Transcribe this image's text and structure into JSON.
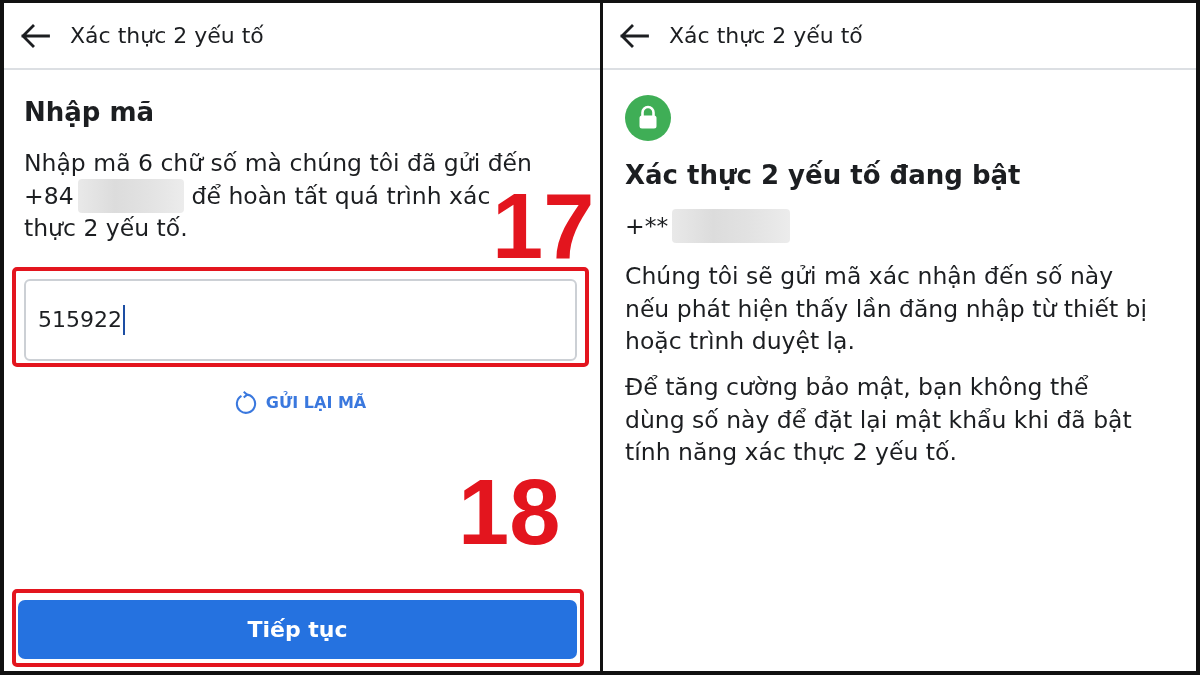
{
  "left_screen": {
    "header": {
      "title": "Xác thực 2 yếu tố"
    },
    "heading": "Nhập mã",
    "description_lines": [
      {
        "kind": "text",
        "text": "Nhập mã 6 chữ số mà chúng tôi đã gửi đến"
      },
      {
        "kind": "redacted",
        "before": "+84",
        "after": "để hoàn tất quá trình xác"
      },
      {
        "kind": "text",
        "text": "thực 2 yếu tố."
      }
    ],
    "code_input": {
      "value": "515922",
      "focused": true,
      "highlighted": true,
      "step_number": "17"
    },
    "resend_link": {
      "label": "GỬI LẠI MÃ"
    },
    "continue_button": {
      "label": "Tiếp tục",
      "highlighted": true,
      "step_number": "18"
    }
  },
  "right_screen": {
    "header": {
      "title": "Xác thực 2 yếu tố"
    },
    "heading": "Xác thực 2 yếu tố đang bật",
    "phone_line": {
      "kind": "redacted",
      "before": "+**"
    },
    "paragraphs": [
      "Chúng tôi sẽ gửi mã xác nhận đến số này nếu phát hiện thấy lần đăng nhập từ thiết bị hoặc trình duyệt lạ.",
      "Để tăng cường bảo mật, bạn không thể dùng số này để đặt lại mật khẩu khi đã bật tính năng xác thực 2 yếu tố."
    ]
  }
}
